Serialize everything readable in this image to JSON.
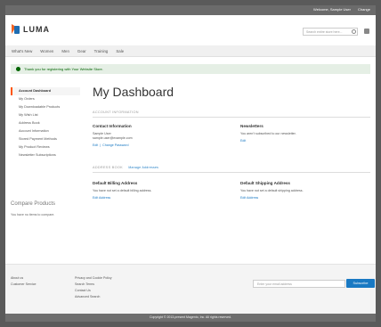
{
  "topbar": {
    "links": [
      "Welcome, Sample User",
      "Change"
    ]
  },
  "logo": {
    "text": "LUMA"
  },
  "search": {
    "placeholder": "Search entire store here..."
  },
  "nav": {
    "items": [
      "What's New",
      "Women",
      "Men",
      "Gear",
      "Training",
      "Sale"
    ]
  },
  "message": {
    "text": "Thank you for registering with Your Website Store."
  },
  "sidebar": {
    "items": [
      "Account Dashboard",
      "My Orders",
      "My Downloadable Products",
      "My Wish List",
      "Address Book",
      "Account Information",
      "Stored Payment Methods",
      "My Product Reviews",
      "Newsletter Subscriptions"
    ],
    "compare_title": "Compare Products",
    "compare_text": "You have no items to compare."
  },
  "main": {
    "title": "My Dashboard",
    "account_info_heading": "Account Information",
    "contact": {
      "title": "Contact Information",
      "name": "Sample User",
      "email": "sample.user@example.com",
      "edit": "Edit",
      "change_password": "Change Password"
    },
    "newsletters": {
      "title": "Newsletters",
      "text": "You aren't subscribed to our newsletter.",
      "edit": "Edit"
    },
    "address_book_heading": "Address Book",
    "manage_addresses": "Manage Addresses",
    "billing": {
      "title": "Default Billing Address",
      "text": "You have not set a default billing address.",
      "edit": "Edit Address"
    },
    "shipping": {
      "title": "Default Shipping Address",
      "text": "You have not set a default shipping address.",
      "edit": "Edit Address"
    }
  },
  "footer": {
    "col1": [
      "About us",
      "Customer Service"
    ],
    "col2": [
      "Privacy and Cookie Policy",
      "Search Terms",
      "Contact Us",
      "Advanced Search"
    ],
    "newsletter_placeholder": "Enter your email address",
    "subscribe": "Subscribe"
  },
  "copyright": "Copyright © 2013-present Magento, Inc. All rights reserved."
}
